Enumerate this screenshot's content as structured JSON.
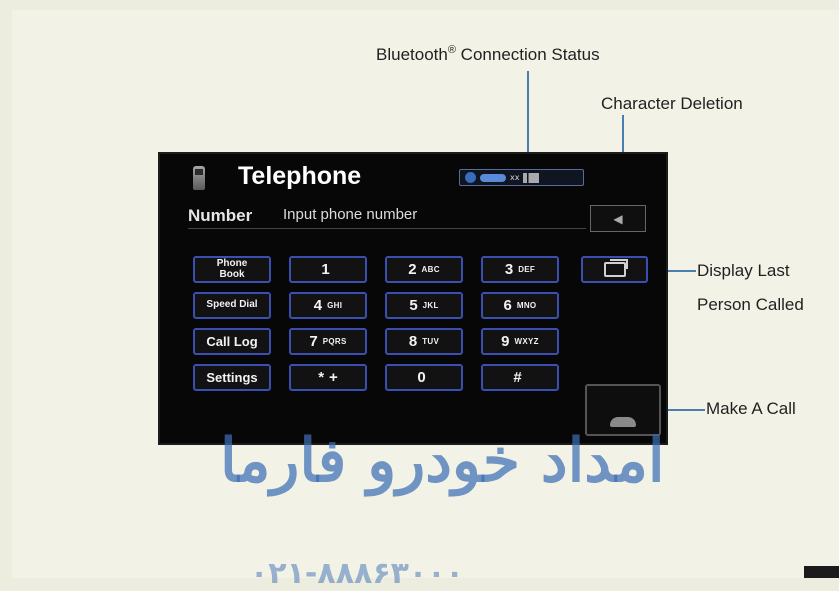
{
  "annotations": {
    "bluetooth_status": "Bluetooth",
    "bluetooth_reg": "®",
    "bluetooth_status_rest": " Connection Status",
    "character_deletion": "Character Deletion",
    "display_last_line1": "Display Last",
    "display_last_line2": "Person Called",
    "make_a_call": "Make A Call"
  },
  "screen": {
    "title": "Telephone",
    "number_label": "Number",
    "number_placeholder": "Input phone number",
    "status_text": "xx"
  },
  "side_buttons": [
    {
      "label": "Phone\nBook"
    },
    {
      "label": "Speed Dial"
    },
    {
      "label": "Call Log"
    },
    {
      "label": "Settings"
    }
  ],
  "keypad": [
    {
      "digit": "1",
      "letters": ""
    },
    {
      "digit": "2",
      "letters": "ABC"
    },
    {
      "digit": "3",
      "letters": "DEF"
    },
    {
      "digit": "4",
      "letters": "GHI"
    },
    {
      "digit": "5",
      "letters": "JKL"
    },
    {
      "digit": "6",
      "letters": "MNO"
    },
    {
      "digit": "7",
      "letters": "PQRS"
    },
    {
      "digit": "8",
      "letters": "TUV"
    },
    {
      "digit": "9",
      "letters": "WXYZ"
    },
    {
      "digit": "*",
      "letters": "+"
    },
    {
      "digit": "0",
      "letters": ""
    },
    {
      "digit": "#",
      "letters": ""
    }
  ],
  "icons": {
    "phone": "phone-icon",
    "bluetooth": "bluetooth-icon",
    "battery": "battery-icon",
    "signal": "signal-icon",
    "delete": "backspace-icon",
    "redial": "redial-icon",
    "call": "handset-icon"
  },
  "watermark": {
    "arabic": "امداد خودرو فارما",
    "phone": "۰۲۱-۸۸۸۶۳۰۰۰"
  },
  "colors": {
    "key_border": "#3b4fb0",
    "screen_bg": "#070707",
    "leader_line": "#4a7db0",
    "watermark": "#3c6eb4"
  }
}
